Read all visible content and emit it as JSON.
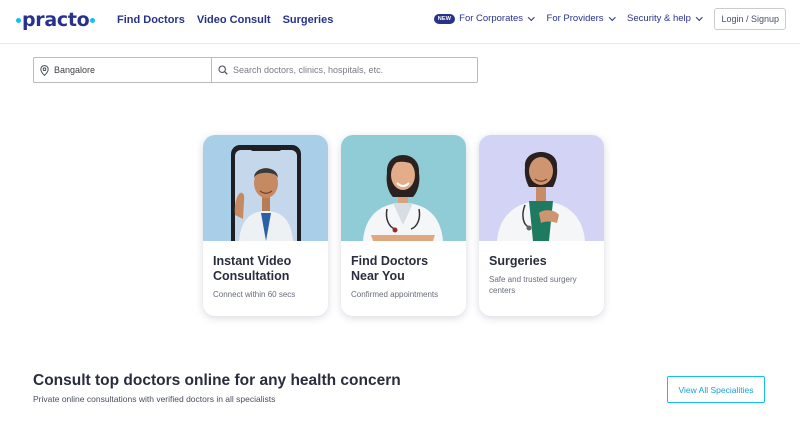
{
  "brand": {
    "logo_text": "practo"
  },
  "nav": {
    "left": [
      "Find Doctors",
      "Video Consult",
      "Surgeries"
    ],
    "right": [
      {
        "badge": "NEW",
        "label": "For Corporates"
      },
      {
        "badge": "",
        "label": "For Providers"
      },
      {
        "badge": "",
        "label": "Security & help"
      }
    ],
    "login_label": "Login / Signup"
  },
  "search": {
    "location_value": "Bangalore",
    "query_placeholder": "Search doctors, clinics, hospitals, etc."
  },
  "cards": [
    {
      "title": "Instant Video Consultation",
      "subtitle": "Connect within 60 secs",
      "bg": "#a9cfe8"
    },
    {
      "title": "Find Doctors Near You",
      "subtitle": "Confirmed appointments",
      "bg": "#8fccd6"
    },
    {
      "title": "Surgeries",
      "subtitle": "Safe and trusted surgery centers",
      "bg": "#d3d4f5"
    }
  ],
  "consult_section": {
    "title": "Consult top doctors online for any health concern",
    "subtitle": "Private online consultations with verified doctors in all specialists",
    "view_all_label": "View All Specialities"
  },
  "colors": {
    "brand_navy": "#28328c",
    "accent_cyan": "#14bef0"
  },
  "icons": [
    "location-pin-icon",
    "search-icon",
    "chevron-down-icon"
  ]
}
